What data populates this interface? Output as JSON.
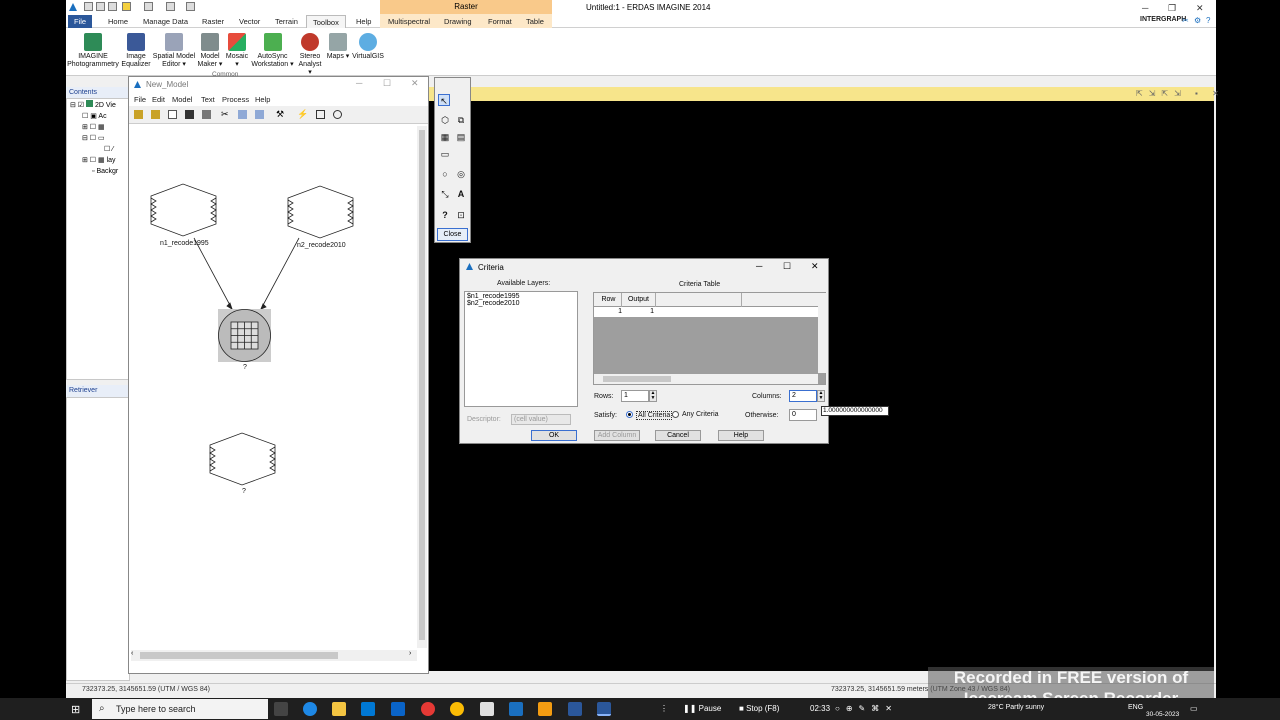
{
  "app": {
    "title": "Untitled:1 - ERDAS IMAGINE 2014",
    "context_tab_group": "Raster",
    "brand": "INTERGRAPH"
  },
  "ribbon_tabs": [
    "File",
    "Home",
    "Manage Data",
    "Raster",
    "Vector",
    "Terrain",
    "Toolbox",
    "Help",
    "Multispectral",
    "Drawing",
    "Format",
    "Table"
  ],
  "ribbon_buttons": [
    {
      "label": "IMAGINE Photogrammetry"
    },
    {
      "label": "Image Equalizer"
    },
    {
      "label": "Spatial Model Editor ▾"
    },
    {
      "label": "Model Maker ▾"
    },
    {
      "label": "Mosaic ▾"
    },
    {
      "label": "AutoSync Workstation ▾"
    },
    {
      "label": "Stereo Analyst ▾"
    },
    {
      "label": "Maps ▾"
    },
    {
      "label": "VirtualGIS"
    }
  ],
  "ribbon_group": "Common",
  "contents": {
    "header": "Contents",
    "items": [
      "2D Vie",
      "Ac",
      "",
      "",
      "",
      "lay",
      "Backgr"
    ]
  },
  "retriever": {
    "header": "Retriever"
  },
  "model_window": {
    "title": "New_Model",
    "menu": [
      "File",
      "Edit",
      "Model",
      "Text",
      "Process",
      "Help"
    ],
    "nodes": {
      "n1": "n1_recode1995",
      "n2": "n2_recode2010",
      "function": "?",
      "output": "?"
    }
  },
  "palette": {
    "close": "Close"
  },
  "criteria": {
    "title": "Criteria",
    "available_layers_label": "Available Layers:",
    "layers": [
      "$n1_recode1995",
      "$n2_recode2010"
    ],
    "table_label": "Criteria Table",
    "columns": [
      "Row",
      "Output"
    ],
    "rows": [
      [
        "1",
        "1"
      ]
    ],
    "descriptor_label": "Descriptor:",
    "descriptor_value": "(cell value)",
    "rows_label": "Rows:",
    "rows_value": "1",
    "columns_label": "Columns:",
    "columns_value": "2",
    "satisfy_label": "Satisfy:",
    "all_criteria": "All Criteria",
    "any_criteria": "Any Criteria",
    "otherwise_label": "Otherwise:",
    "otherwise_value": "0",
    "tooltip": "1.000000000000000",
    "ok": "OK",
    "add_column": "Add Column",
    "cancel": "Cancel",
    "help": "Help"
  },
  "status": {
    "left": "732373.25, 3145651.59  (UTM / WGS 84)",
    "right": "732373.25, 3145651.59 meters (UTM Zone 43 / WGS 84)"
  },
  "taskbar": {
    "search_placeholder": "Type here to search",
    "pause": "Pause",
    "stop": "Stop (F8)",
    "timer": "02:33",
    "weather": "28°C  Partly sunny",
    "lang": "ENG",
    "date": "30-05-2023"
  },
  "watermark": "Recorded in FREE version of Icecream Screen Recorder"
}
